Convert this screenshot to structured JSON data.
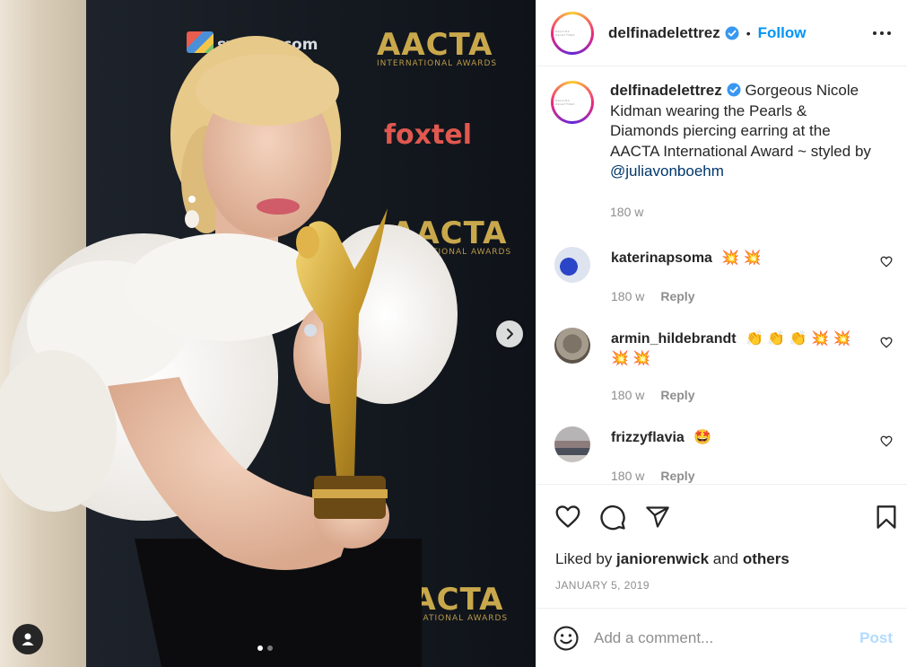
{
  "post": {
    "username": "delfinadelettrez",
    "follow_label": "Follow",
    "separator": "•",
    "caption": {
      "username": "delfinadelettrez",
      "text": "Gorgeous Nicole Kidman wearing the Pearls & Diamonds piercing earring at the AACTA International Award ~ styled by ",
      "mention": "@juliavonboehm",
      "time": "180 w"
    },
    "comments": [
      {
        "username": "katerinapsoma",
        "text": "💥 💥",
        "time": "180 w",
        "reply_label": "Reply"
      },
      {
        "username": "armin_hildebrandt",
        "text": "👏 👏 👏 💥 💥 💥 💥",
        "time": "180 w",
        "reply_label": "Reply"
      },
      {
        "username": "frizzyflavia",
        "text": "🤩",
        "time": "180 w",
        "reply_label": "Reply"
      }
    ],
    "likes": {
      "prefix": "Liked by ",
      "user": "janiorenwick",
      "middle": " and ",
      "others": "others"
    },
    "date": "JANUARY 5, 2019",
    "add_comment": {
      "placeholder": "Add a comment...",
      "post_label": "Post"
    }
  },
  "media": {
    "backdrop_logos": {
      "sydney": "sydney.com",
      "aacta": "AACTA",
      "aacta_sub": "INTERNATIONAL AWARDS",
      "foxtel": "foxtel"
    },
    "carousel": {
      "total": 2,
      "active": 1
    }
  },
  "icons": {
    "verified": "verified-badge-icon",
    "more": "more-options-icon",
    "like": "heart-icon",
    "comment": "comment-icon",
    "share": "share-icon",
    "save": "bookmark-icon",
    "emoji": "emoji-icon",
    "next": "chevron-right-icon",
    "tag": "user-tag-icon"
  },
  "colors": {
    "accent": "#0095f6",
    "verified": "#3897f0",
    "post_disabled": "#b3dbff"
  }
}
